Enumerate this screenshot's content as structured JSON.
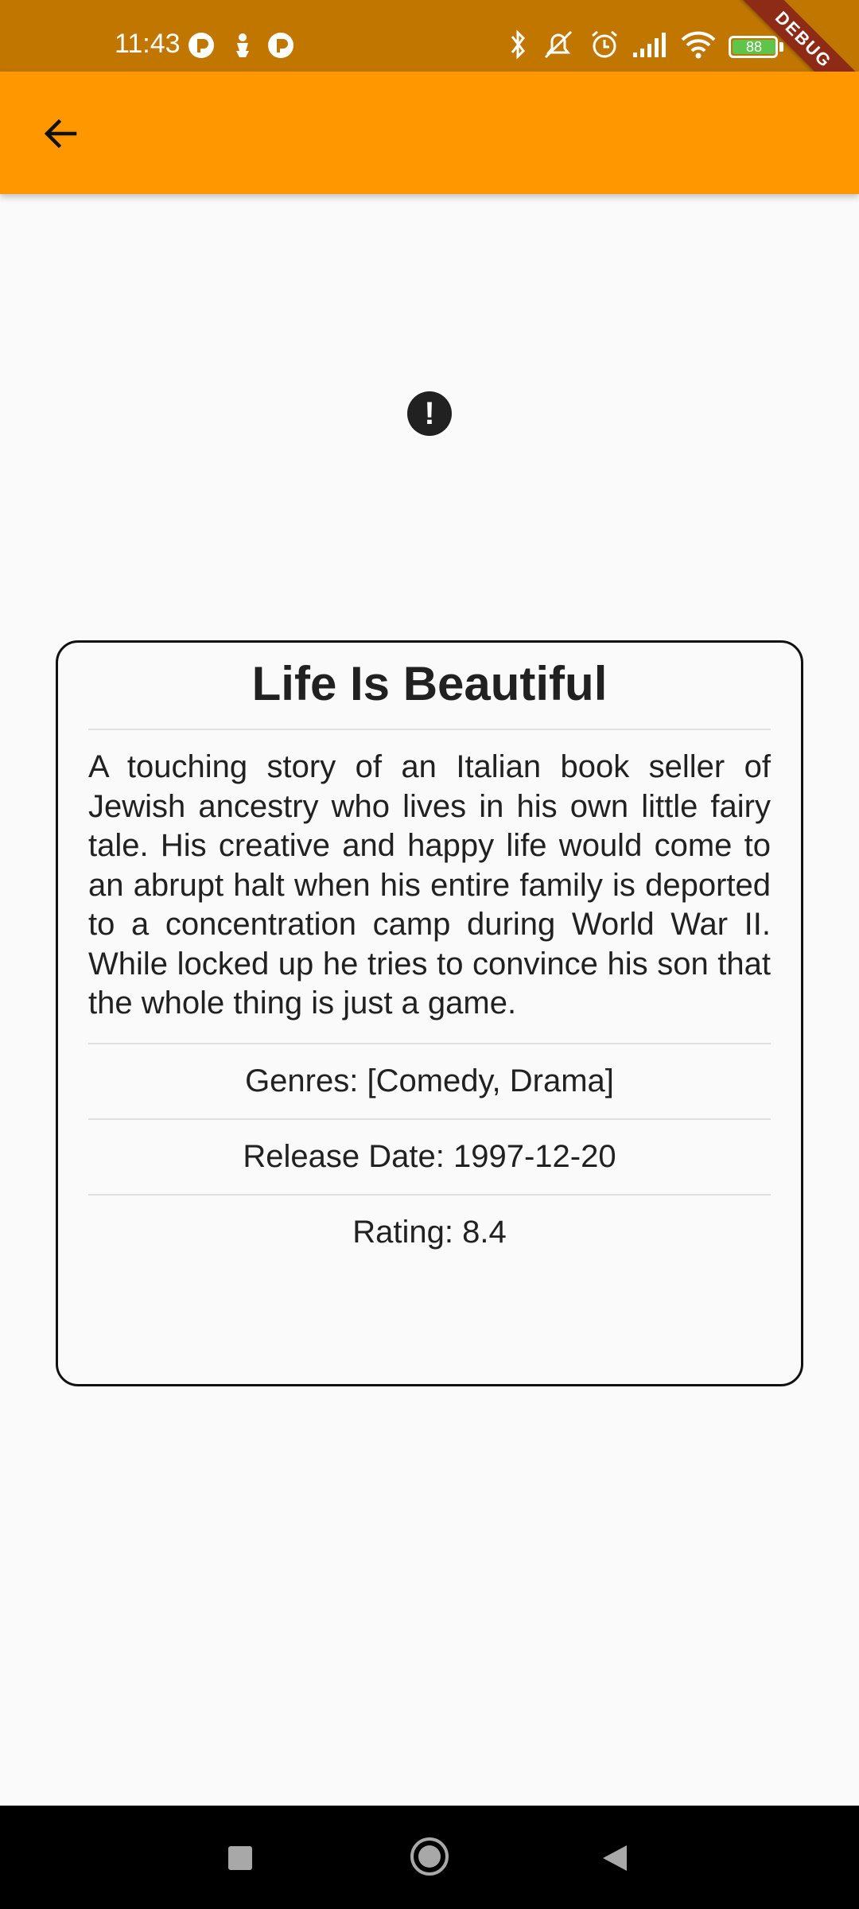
{
  "status_bar": {
    "time": "11:43",
    "battery_level": "88",
    "debug_banner": "DEBUG"
  },
  "app_bar": {
    "back_icon": "arrow-back-icon"
  },
  "error_icon": "error-icon",
  "movie": {
    "title": "Life Is Beautiful",
    "overview": "A touching story of an Italian book seller of Jewish ancestry who lives in his own little fairy tale. His creative and happy life would come to an abrupt halt when his entire family is deported to a concentration camp during World War II. While locked up he tries to convince his son that the whole thing is just a game.",
    "genres": "Genres: [Comedy, Drama]",
    "release_date": "Release Date: 1997-12-20",
    "rating": "Rating: 8.4"
  },
  "colors": {
    "status_bar": "#c17600",
    "app_bar": "#ff9800",
    "background": "#fafafa",
    "card_border": "#111111",
    "debug_ribbon": "#8e2b17"
  },
  "nav_bar": {
    "recents": "recents-square-icon",
    "home": "home-circle-icon",
    "back": "back-triangle-icon"
  }
}
